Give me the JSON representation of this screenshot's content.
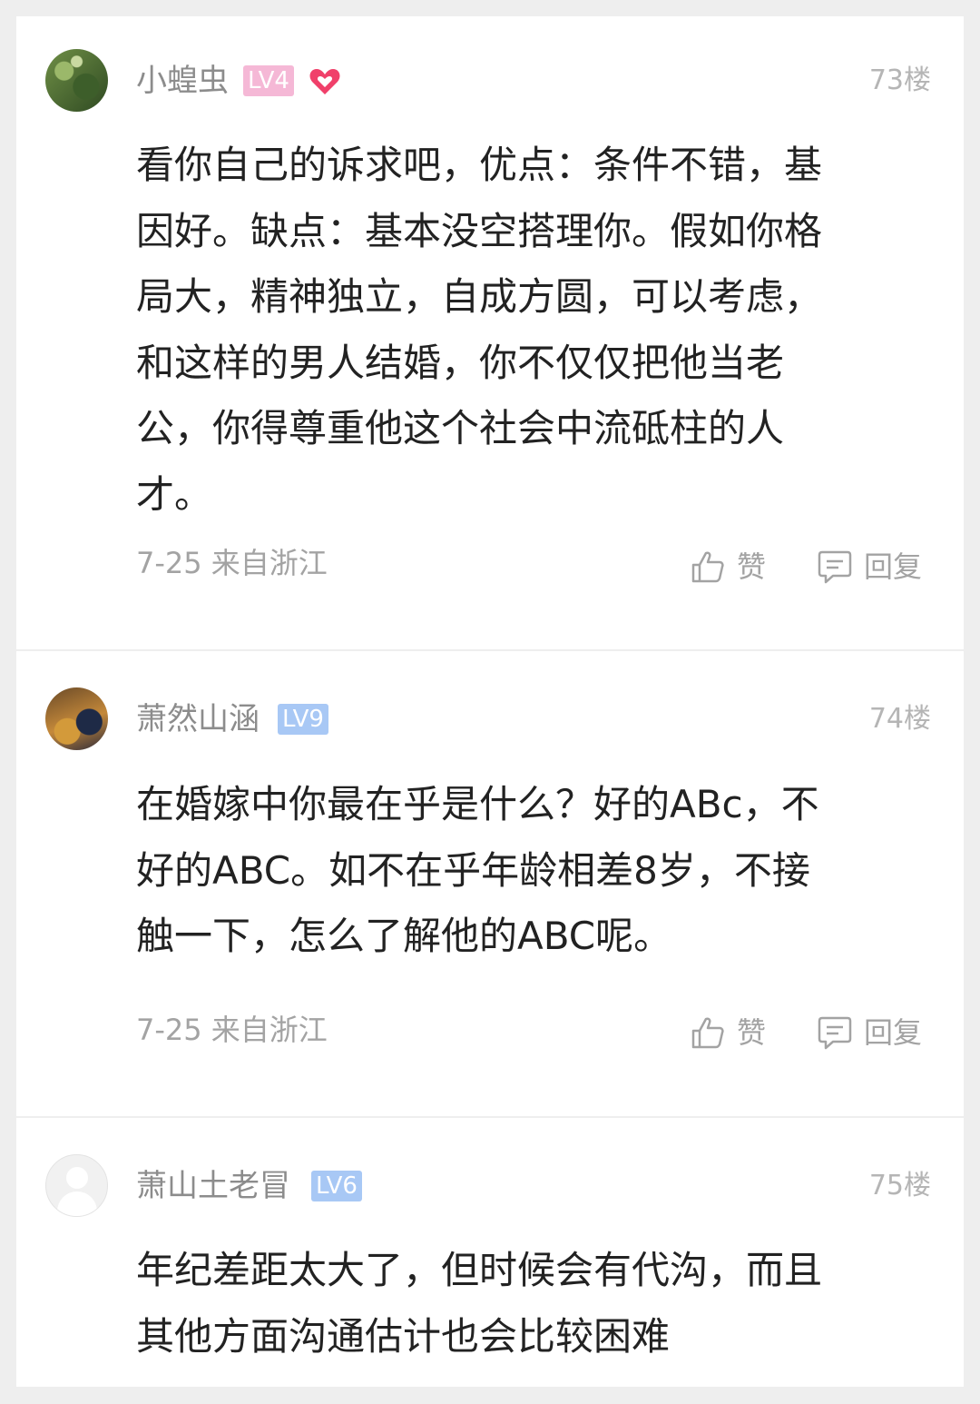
{
  "comments": [
    {
      "username": "小蝗虫",
      "level": "LV4",
      "floor": "73楼",
      "content_lines": [
        "看你自己的诉求吧，优点：条件不错，基",
        "因好。缺点：基本没空搭理你。假如你格",
        "局大，精神独立，自成方圆，可以考虑，",
        "和这样的男人结婚，你不仅仅把他当老",
        "公，你得尊重他这个社会中流砥柱的人",
        "才。"
      ],
      "meta": "7-25 来自浙江",
      "like_label": "赞",
      "reply_label": "回复"
    },
    {
      "username": "萧然山涵",
      "level": "LV9",
      "floor": "74楼",
      "content_lines": [
        "在婚嫁中你最在乎是什么？好的ABc，不",
        "好的ABC。如不在乎年龄相差8岁，不接",
        "触一下，怎么了解他的ABC呢。"
      ],
      "meta": "7-25 来自浙江",
      "like_label": "赞",
      "reply_label": "回复"
    },
    {
      "username": "萧山土老冒",
      "level": "LV6",
      "floor": "75楼",
      "content_lines": [
        "年纪差距太大了，但时候会有代沟，而且",
        "其他方面沟通估计也会比较困难"
      ]
    }
  ],
  "colors": {
    "page_bg": "#eeeeee",
    "card_bg": "#ffffff",
    "level_pink": "#f5b8d6",
    "level_blue": "#a8c8f5",
    "heart": "#f0406a"
  }
}
